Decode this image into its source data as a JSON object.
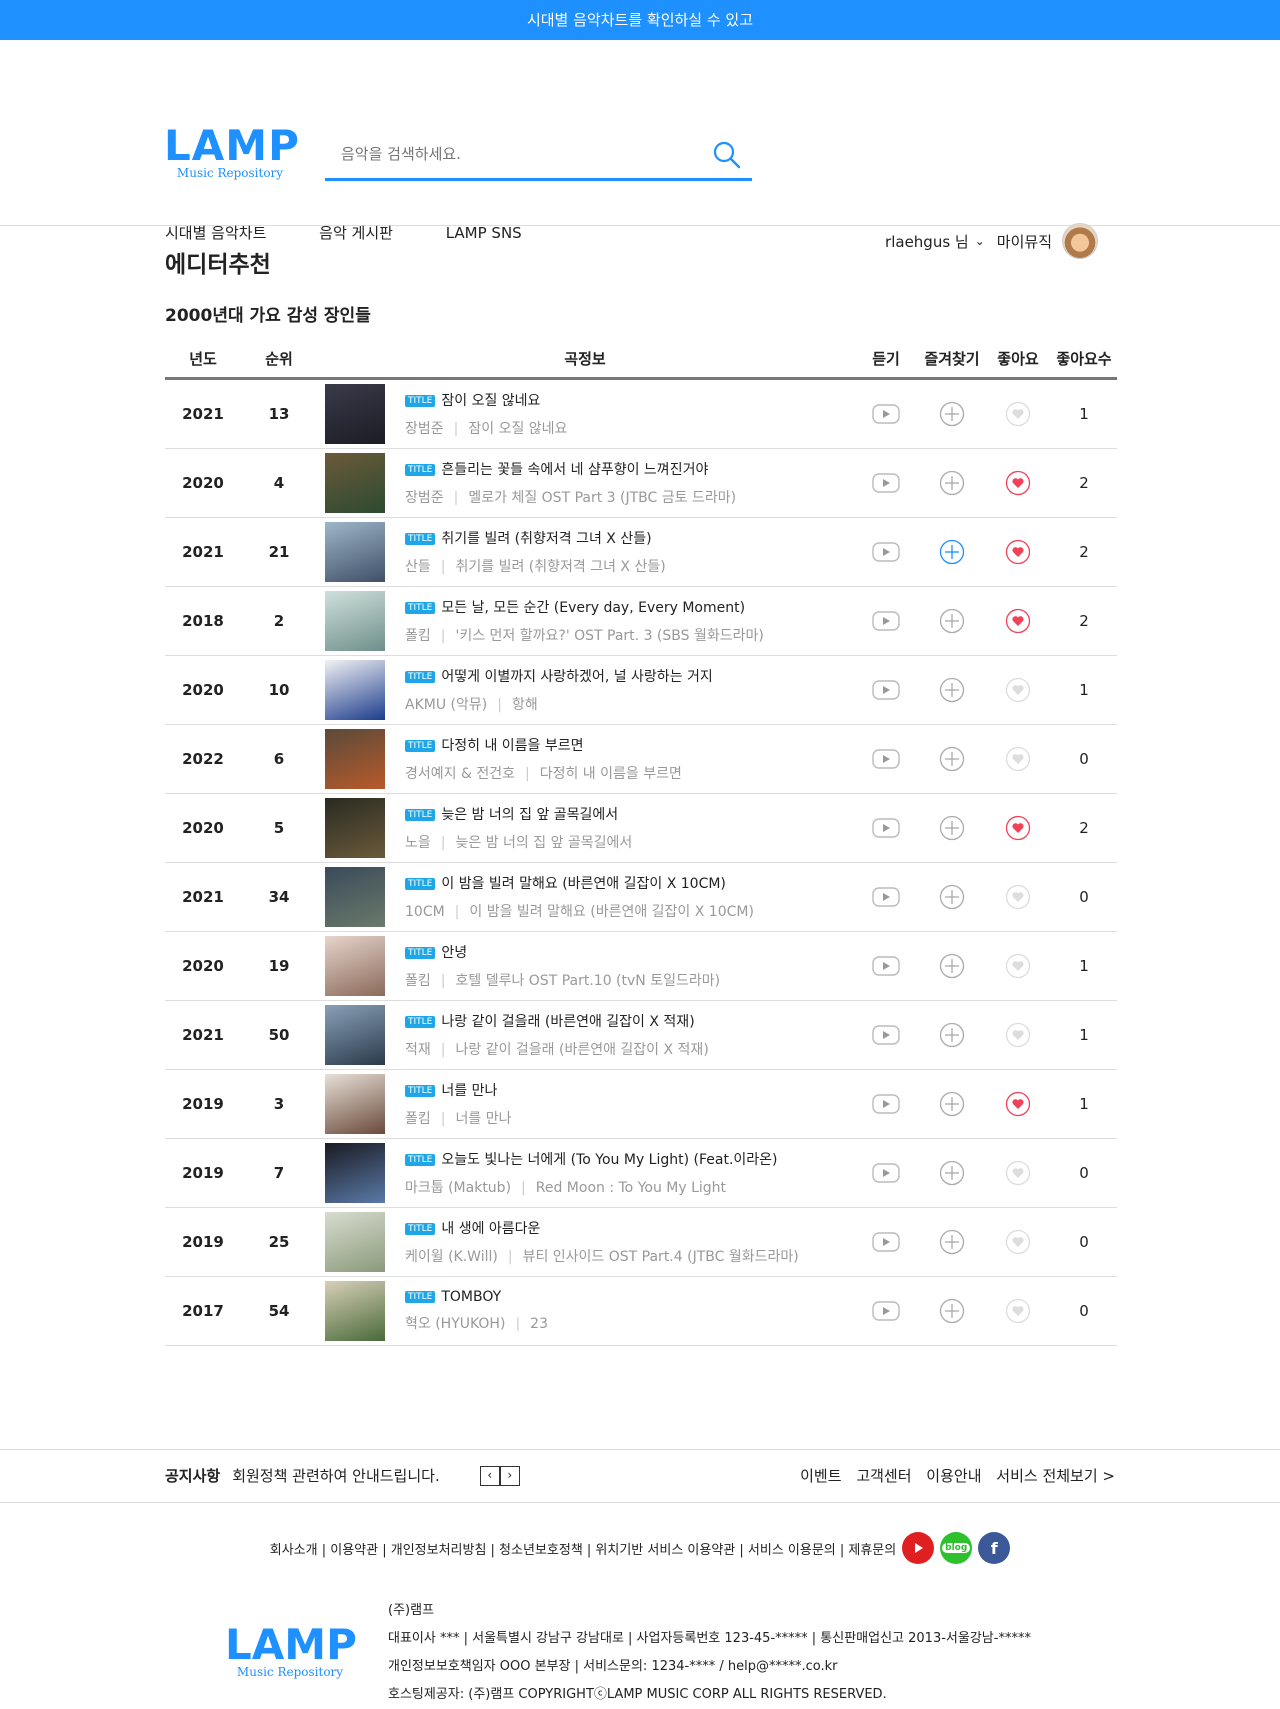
{
  "topbar": {
    "text": "시대별 음악차트를 확인하실 수 있고"
  },
  "logo": {
    "main": "LAMP",
    "sub": "Music Repository"
  },
  "search": {
    "placeholder": "음악을 검색하세요."
  },
  "nav": [
    "시대별 음악차트",
    "음악 게시판",
    "LAMP SNS"
  ],
  "user": {
    "name": "rlaehgus 님",
    "mymusic": "마이뮤직"
  },
  "page_title": "에디터추천",
  "section_title": "2000년대 가요 감성 장인들",
  "columns": {
    "year": "년도",
    "rank": "순위",
    "info": "곡정보",
    "listen": "듣기",
    "favorite": "즐겨찾기",
    "like": "좋아요",
    "like_count": "좋아요수"
  },
  "badge": "TITLE",
  "songs": [
    {
      "year": "2021",
      "rank": "13",
      "title": "잠이 오질 않네요",
      "artist": "장범준",
      "album": "잠이 오질 않네요",
      "liked": false,
      "fav": false,
      "likes": "1",
      "cover": [
        "#3a3a4a",
        "#1c1c24"
      ]
    },
    {
      "year": "2020",
      "rank": "4",
      "title": "흔들리는 꽃들 속에서 네 샴푸향이 느껴진거야",
      "artist": "장범준",
      "album": "멜로가 체질 OST Part 3 (JTBC 금토 드라마)",
      "liked": true,
      "fav": false,
      "likes": "2",
      "cover": [
        "#6b5a3a",
        "#2d4a30"
      ]
    },
    {
      "year": "2021",
      "rank": "21",
      "title": "취기를 빌려 (취향저격 그녀 X 산들)",
      "artist": "산들",
      "album": "취기를 빌려 (취향저격 그녀 X 산들)",
      "liked": true,
      "fav": true,
      "likes": "2",
      "cover": [
        "#9fb6c8",
        "#3f4f68"
      ]
    },
    {
      "year": "2018",
      "rank": "2",
      "title": "모든 날, 모든 순간 (Every day, Every Moment)",
      "artist": "폴킴",
      "album": "'키스 먼저 할까요?' OST Part. 3 (SBS 월화드라마)",
      "liked": true,
      "fav": false,
      "likes": "2",
      "cover": [
        "#cfe0dc",
        "#6f8f8a"
      ]
    },
    {
      "year": "2020",
      "rank": "10",
      "title": "어떻게 이별까지 사랑하겠어, 널 사랑하는 거지",
      "artist": "AKMU (악뮤)",
      "album": "항해",
      "liked": false,
      "fav": false,
      "likes": "1",
      "cover": [
        "#f2f2f4",
        "#1c3c8c"
      ]
    },
    {
      "year": "2022",
      "rank": "6",
      "title": "다정히 내 이름을 부르면",
      "artist": "경서예지 & 전건호",
      "album": "다정히 내 이름을 부르면",
      "liked": false,
      "fav": false,
      "likes": "0",
      "cover": [
        "#5a4a3a",
        "#b85a2a"
      ]
    },
    {
      "year": "2020",
      "rank": "5",
      "title": "늦은 밤 너의 집 앞 골목길에서",
      "artist": "노을",
      "album": "늦은 밤 너의 집 앞 골목길에서",
      "liked": true,
      "fav": false,
      "likes": "2",
      "cover": [
        "#2a2a22",
        "#6a5a3a"
      ]
    },
    {
      "year": "2021",
      "rank": "34",
      "title": "이 밤을 빌려 말해요 (바른연애 길잡이 X 10CM)",
      "artist": "10CM",
      "album": "이 밤을 빌려 말해요 (바른연애 길잡이 X 10CM)",
      "liked": false,
      "fav": false,
      "likes": "0",
      "cover": [
        "#3a4a5a",
        "#6a7a6a"
      ]
    },
    {
      "year": "2020",
      "rank": "19",
      "title": "안녕",
      "artist": "폴킴",
      "album": "호텔 델루나 OST Part.10 (tvN 토일드라마)",
      "liked": false,
      "fav": false,
      "likes": "1",
      "cover": [
        "#e6d4cc",
        "#8a6a5a"
      ]
    },
    {
      "year": "2021",
      "rank": "50",
      "title": "나랑 같이 걸을래 (바른연애 길잡이 X 적재)",
      "artist": "적재",
      "album": "나랑 같이 걸을래 (바른연애 길잡이 X 적재)",
      "liked": false,
      "fav": false,
      "likes": "1",
      "cover": [
        "#8aa0b8",
        "#2a3a4a"
      ]
    },
    {
      "year": "2019",
      "rank": "3",
      "title": "너를 만나",
      "artist": "폴킴",
      "album": "너를 만나",
      "liked": true,
      "fav": false,
      "likes": "1",
      "cover": [
        "#e8e0d8",
        "#6a4a3a"
      ]
    },
    {
      "year": "2019",
      "rank": "7",
      "title": "오늘도 빛나는 너에게 (To You My Light) (Feat.이라온)",
      "artist": "마크툽 (Maktub)",
      "album": "Red Moon : To You My Light",
      "liked": false,
      "fav": false,
      "likes": "0",
      "cover": [
        "#1a1a22",
        "#5a7aa8"
      ]
    },
    {
      "year": "2019",
      "rank": "25",
      "title": "내 생에 아름다운",
      "artist": "케이윌 (K.Will)",
      "album": "뷰티 인사이드 OST Part.4 (JTBC 월화드라마)",
      "liked": false,
      "fav": false,
      "likes": "0",
      "cover": [
        "#d8dcd0",
        "#8a9a7a"
      ]
    },
    {
      "year": "2017",
      "rank": "54",
      "title": "TOMBOY",
      "artist": "혁오 (HYUKOH)",
      "album": "23",
      "liked": false,
      "fav": false,
      "likes": "0",
      "cover": [
        "#d8d0b8",
        "#4a6a3a"
      ]
    }
  ],
  "notice": {
    "label": "공지사항",
    "text": "회원정책 관련하여 안내드립니다.",
    "prev": "‹",
    "next": "›"
  },
  "notice_links": [
    "이벤트",
    "고객센터",
    "이용안내",
    "서비스 전체보기 >"
  ],
  "footer_links": "회사소개 | 이용약관 | 개인정보처리방침 | 청소년보호정책 | 위치기반 서비스 이용약관 | 서비스 이용문의 | 제휴문의",
  "social": {
    "blog": "blog",
    "facebook": "f"
  },
  "footer_info": [
    "(주)램프",
    "대표이사 *** | 서울특별시 강남구 강남대로 | 사업자등록번호 123-45-***** | 통신판매업신고 2013-서울강남-*****",
    "개인정보보호책임자 OOO 본부장 | 서비스문의: 1234-**** / help@*****.co.kr",
    "호스팅제공자: (주)램프 COPYRIGHTⓒLAMP MUSIC CORP ALL RIGHTS RESERVED."
  ],
  "colors": {
    "accent": "#1e90ff",
    "badge": "#1ea7e8",
    "heart": "#f0435a"
  }
}
